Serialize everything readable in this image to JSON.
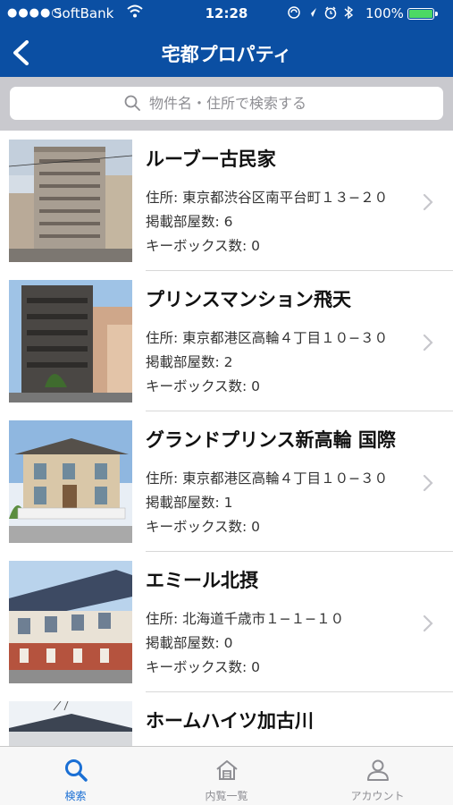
{
  "status_bar": {
    "signal": "●●●●○",
    "carrier": "SoftBank",
    "time": "12:28",
    "battery": "100%"
  },
  "nav": {
    "title": "宅都プロパティ"
  },
  "search": {
    "placeholder": "物件名・住所で検索する"
  },
  "properties": [
    {
      "name": "ルーブー古民家",
      "address": "住所: 東京都渋谷区南平台町１３−２０",
      "rooms": "掲載部屋数: 6",
      "keyboxes": "キーボックス数: 0"
    },
    {
      "name": "プリンスマンション飛天",
      "address": "住所: 東京都港区高輪４丁目１０−３０",
      "rooms": "掲載部屋数: 2",
      "keyboxes": "キーボックス数: 0"
    },
    {
      "name": "グランドプリンス新高輪 国際",
      "address": "住所: 東京都港区高輪４丁目１０−３０",
      "rooms": "掲載部屋数: 1",
      "keyboxes": "キーボックス数: 0"
    },
    {
      "name": "エミール北摂",
      "address": "住所: 北海道千歳市１−１−１０",
      "rooms": "掲載部屋数: 0",
      "keyboxes": "キーボックス数: 0"
    },
    {
      "name": "ホームハイツ加古川",
      "address": "",
      "rooms": "",
      "keyboxes": ""
    }
  ],
  "tabs": [
    {
      "label": "検索",
      "icon": "search-icon",
      "active": true
    },
    {
      "label": "内覧一覧",
      "icon": "house-icon",
      "active": false
    },
    {
      "label": "アカウント",
      "icon": "person-icon",
      "active": false
    }
  ],
  "colors": {
    "nav_blue": "#0b4fa3",
    "tab_active": "#1a6fd4",
    "tab_inactive": "#8e8e93"
  }
}
